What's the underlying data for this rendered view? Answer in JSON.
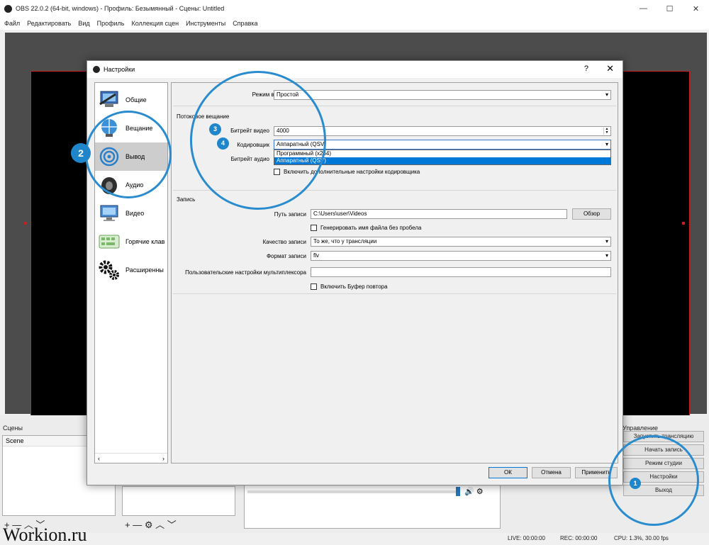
{
  "window": {
    "title": "OBS 22.0.2 (64-bit, windows) - Профиль: Безымянный - Сцены: Untitled",
    "controls": [
      "—",
      "☐",
      "✕"
    ]
  },
  "menu": [
    "Файл",
    "Редактировать",
    "Вид",
    "Профиль",
    "Коллекция сцен",
    "Инструменты",
    "Справка"
  ],
  "docks": {
    "scenes_title": "Сцены",
    "scenes": [
      "Scene"
    ],
    "controls_title": "Управление",
    "controls": [
      "Запустить трансляцию",
      "Начать запись",
      "Режим студии",
      "Настройки",
      "Выход"
    ],
    "toolbar_symbols": "+ — ︿ ﹀",
    "sources_toolbar_symbols": "+ — ⚙ ︿ ﹀"
  },
  "status": {
    "live": "LIVE: 00:00:00",
    "rec": "REC: 00:00:00",
    "cpu": "CPU: 1.3%, 30.00 fps"
  },
  "watermark": "Workion.ru",
  "dialog": {
    "title": "Настройки",
    "help": "?",
    "close": "✕",
    "categories": [
      {
        "label": "Общие",
        "icon": "general-icon"
      },
      {
        "label": "Вещание",
        "icon": "stream-icon"
      },
      {
        "label": "Вывод",
        "icon": "output-icon"
      },
      {
        "label": "Аудио",
        "icon": "audio-icon"
      },
      {
        "label": "Видео",
        "icon": "video-icon"
      },
      {
        "label": "Горячие клав",
        "icon": "hotkeys-icon"
      },
      {
        "label": "Расширенны",
        "icon": "advanced-icon"
      }
    ],
    "selected_category": "Вывод",
    "output_mode_label": "Режим вывода",
    "output_mode_value": "Простой",
    "streaming_section": "Потоковое вещание",
    "video_bitrate_label": "Битрейт видео",
    "video_bitrate_value": "4000",
    "encoder_label": "Кодировщик",
    "encoder_value": "Аппаратный (QSV)",
    "encoder_options": [
      "Программный (x264)",
      "Аппаратный (QSV)"
    ],
    "audio_bitrate_label": "Битрейт аудио",
    "advanced_encoder_checkbox": "Включить дополнительные настройки кодировщика",
    "recording_section": "Запись",
    "record_path_label": "Путь записи",
    "record_path_value": "C:\\Users\\user\\Videos",
    "browse_button": "Обзор",
    "no_space_checkbox": "Генерировать имя файла без пробела",
    "quality_label": "Качество записи",
    "quality_value": "То же, что у трансляции",
    "format_label": "Формат записи",
    "format_value": "flv",
    "muxer_label": "Пользовательские настройки мультиплексора",
    "muxer_value": "",
    "replay_buffer_checkbox": "Включить Буфер повтора",
    "ok_button": "ОК",
    "cancel_button": "Отмена",
    "apply_button": "Применить"
  },
  "annotations": [
    "1",
    "2",
    "3",
    "4"
  ],
  "colors": {
    "annotation_blue": "#2a8ccf",
    "selection_blue": "#0078d7",
    "preview_border": "#c82020"
  }
}
